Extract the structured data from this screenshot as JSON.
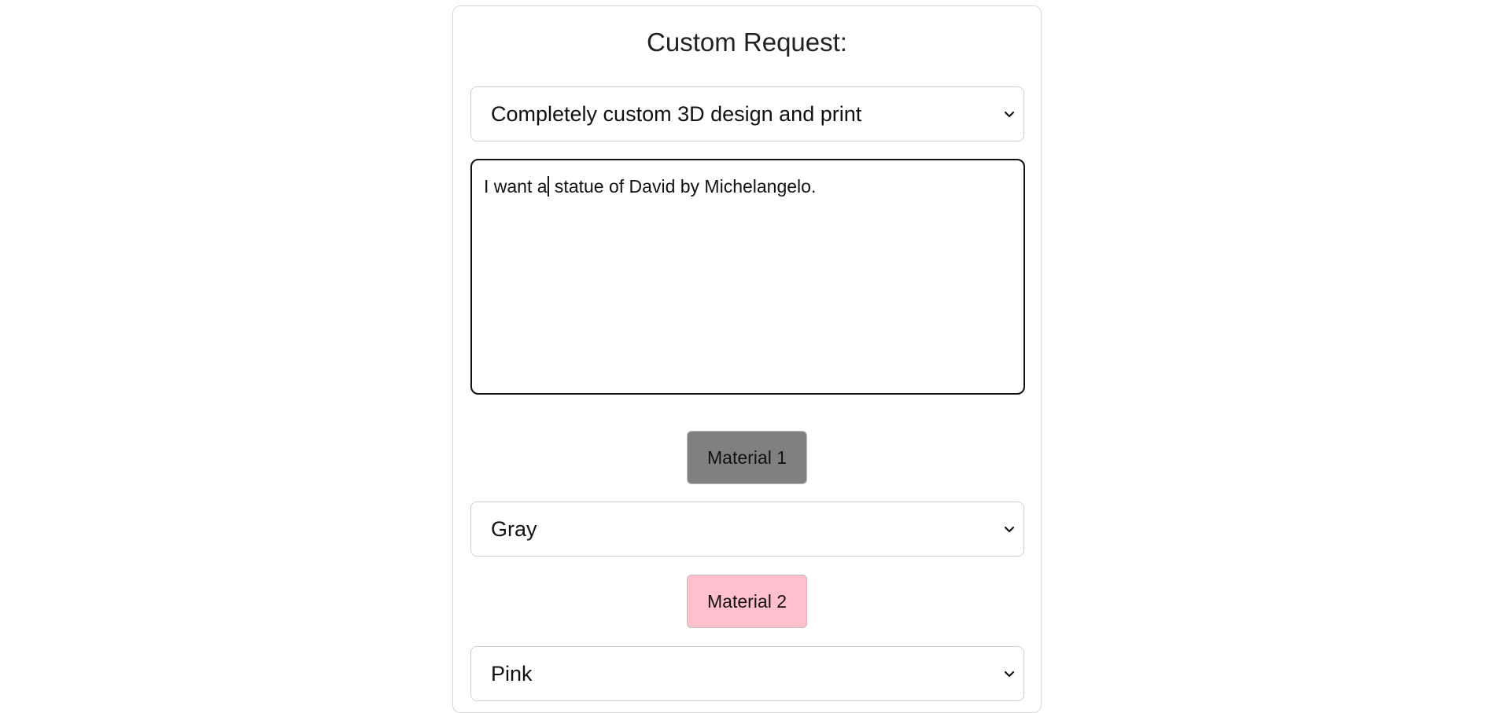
{
  "form": {
    "title": "Custom Request:",
    "request_type": {
      "selected": "Completely custom 3D design and print"
    },
    "description": {
      "text_before_caret": "I want a",
      "text_after_caret": " statue of David by Michelangelo."
    },
    "material_1": {
      "label": "Material 1",
      "color": "#808080",
      "selected": "Gray"
    },
    "material_2": {
      "label": "Material 2",
      "color": "#ffc0cb",
      "selected": "Pink"
    }
  },
  "icons": {
    "dropdown": "chevron-down-icon"
  }
}
